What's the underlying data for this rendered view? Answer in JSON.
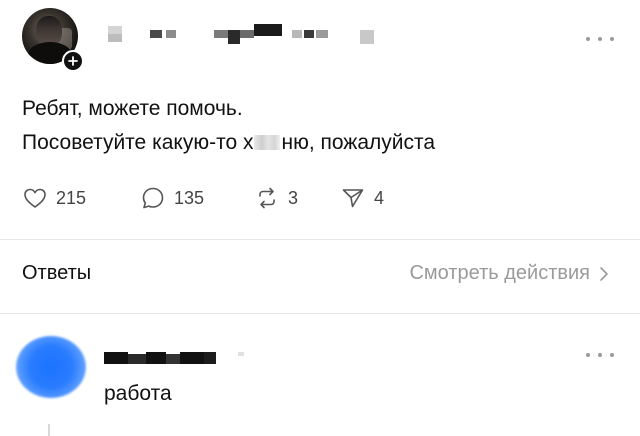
{
  "post": {
    "author": {
      "avatar_icon": "user-avatar-photo",
      "follow_icon": "plus-icon"
    },
    "text_line1": "Ребят, можете помочь.",
    "text_line2_before": "Посоветуйте какую-то х",
    "text_line2_after": "ню, пожалуйста",
    "more_icon": "more-dots-icon"
  },
  "actions": {
    "likes": "215",
    "comments": "135",
    "reposts": "3",
    "shares": "4"
  },
  "replies_header": {
    "title": "Ответы",
    "view_activity": "Смотреть действия"
  },
  "reply": {
    "text": "работа",
    "avatar_color": "#1a73ff"
  }
}
